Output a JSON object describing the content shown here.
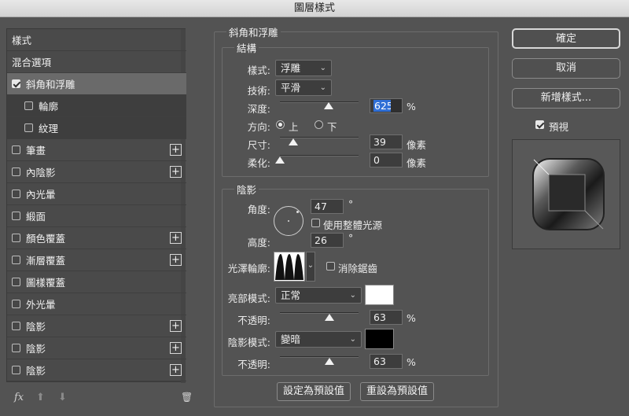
{
  "window": {
    "title": "圖層樣式"
  },
  "sidebar": {
    "items": [
      {
        "label": "樣式",
        "checkbox": false,
        "checked": false,
        "plus": false,
        "state": "normal"
      },
      {
        "label": "混合選項",
        "checkbox": false,
        "checked": false,
        "plus": false,
        "state": "normal"
      },
      {
        "label": "斜角和浮雕",
        "checkbox": true,
        "checked": true,
        "plus": false,
        "state": "selected"
      },
      {
        "label": "輪廓",
        "checkbox": true,
        "checked": false,
        "plus": false,
        "state": "sub"
      },
      {
        "label": "紋理",
        "checkbox": true,
        "checked": false,
        "plus": false,
        "state": "sub"
      },
      {
        "label": "筆畫",
        "checkbox": true,
        "checked": false,
        "plus": true,
        "state": "normal"
      },
      {
        "label": "內陰影",
        "checkbox": true,
        "checked": false,
        "plus": true,
        "state": "normal"
      },
      {
        "label": "內光暈",
        "checkbox": true,
        "checked": false,
        "plus": false,
        "state": "normal"
      },
      {
        "label": "緞面",
        "checkbox": true,
        "checked": false,
        "plus": false,
        "state": "normal"
      },
      {
        "label": "顏色覆蓋",
        "checkbox": true,
        "checked": false,
        "plus": true,
        "state": "normal"
      },
      {
        "label": "漸層覆蓋",
        "checkbox": true,
        "checked": false,
        "plus": true,
        "state": "normal"
      },
      {
        "label": "圖樣覆蓋",
        "checkbox": true,
        "checked": false,
        "plus": false,
        "state": "normal"
      },
      {
        "label": "外光暈",
        "checkbox": true,
        "checked": false,
        "plus": false,
        "state": "normal"
      },
      {
        "label": "陰影",
        "checkbox": true,
        "checked": false,
        "plus": true,
        "state": "normal"
      },
      {
        "label": "陰影",
        "checkbox": true,
        "checked": false,
        "plus": true,
        "state": "normal"
      },
      {
        "label": "陰影",
        "checkbox": true,
        "checked": false,
        "plus": true,
        "state": "normal"
      }
    ],
    "plus_glyph": "+",
    "footer": {
      "fx": "fx",
      "up": "⬆",
      "down": "⬇",
      "trash": "🗑"
    }
  },
  "bevel": {
    "section_title": "斜角和浮雕",
    "structure": {
      "title": "結構",
      "style_label": "樣式:",
      "style_value": "浮雕",
      "technique_label": "技術:",
      "technique_value": "平滑",
      "depth_label": "深度:",
      "depth_value": "625",
      "depth_unit": "%",
      "depth_level": 0.62,
      "direction_label": "方向:",
      "direction_up": "上",
      "direction_down": "下",
      "direction_selected": "上",
      "size_label": "尺寸:",
      "size_value": "39",
      "size_unit": "像素",
      "size_level": 0.17,
      "soften_label": "柔化:",
      "soften_value": "0",
      "soften_unit": "像素",
      "soften_level": 0.0
    },
    "shading": {
      "title": "陰影",
      "angle_label": "角度:",
      "angle_value": "47",
      "angle_unit": "°",
      "global_light_label": "使用整體光源",
      "altitude_label": "高度:",
      "altitude_value": "26",
      "altitude_unit": "°",
      "gloss_label": "光澤輪廓:",
      "antialias_label": "消除鋸齒",
      "highlight_label": "亮部模式:",
      "highlight_mode": "正常",
      "highlight_color": "#ffffff",
      "highlight_opacity_label": "不透明:",
      "highlight_opacity": "63",
      "highlight_opacity_unit": "%",
      "highlight_opacity_level": 0.63,
      "shadow_label": "陰影模式:",
      "shadow_mode": "變暗",
      "shadow_color": "#000000",
      "shadow_opacity_label": "不透明:",
      "shadow_opacity": "63",
      "shadow_opacity_unit": "%",
      "shadow_opacity_level": 0.63
    },
    "set_default": "設定為預設值",
    "reset_default": "重設為預設值"
  },
  "actions": {
    "ok": "確定",
    "cancel": "取消",
    "new_style": "新增樣式...",
    "preview_label": "預視",
    "preview_checked": true
  },
  "colors": {
    "accent": "#2f6fd6",
    "panel": "#535353"
  }
}
